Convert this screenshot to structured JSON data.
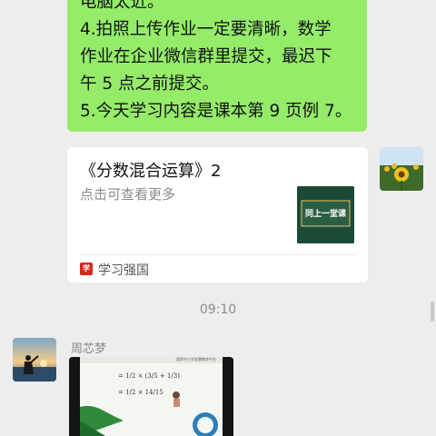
{
  "chat": {
    "message_lines": [
      "电脑太近。",
      "4.拍照上传作业一定要清晰，数学",
      "作业在企业微信群里提交，最迟下",
      "午 5 点之前提交。",
      "5.今天学习内容是课本第 9 页例 7。"
    ],
    "link_card": {
      "title": "《分数混合运算》2",
      "subtitle": "点击可查看更多",
      "thumbnail_text": "同上一堂课",
      "source_icon_text": "学",
      "source": "学习强国"
    },
    "timestamp": "09:10",
    "sender_name": "周芯梦",
    "video": {
      "header_text": "国家中小学智慧教育平台",
      "board_line_1": "= 1/2 × (3/5 + 1/3)",
      "board_line_2": "= 1/2 × 14/15"
    }
  },
  "colors": {
    "sent_bubble": "#95ec69",
    "background": "#ededed",
    "card_thumb": "#1d4a36",
    "source_red": "#d9251c"
  }
}
